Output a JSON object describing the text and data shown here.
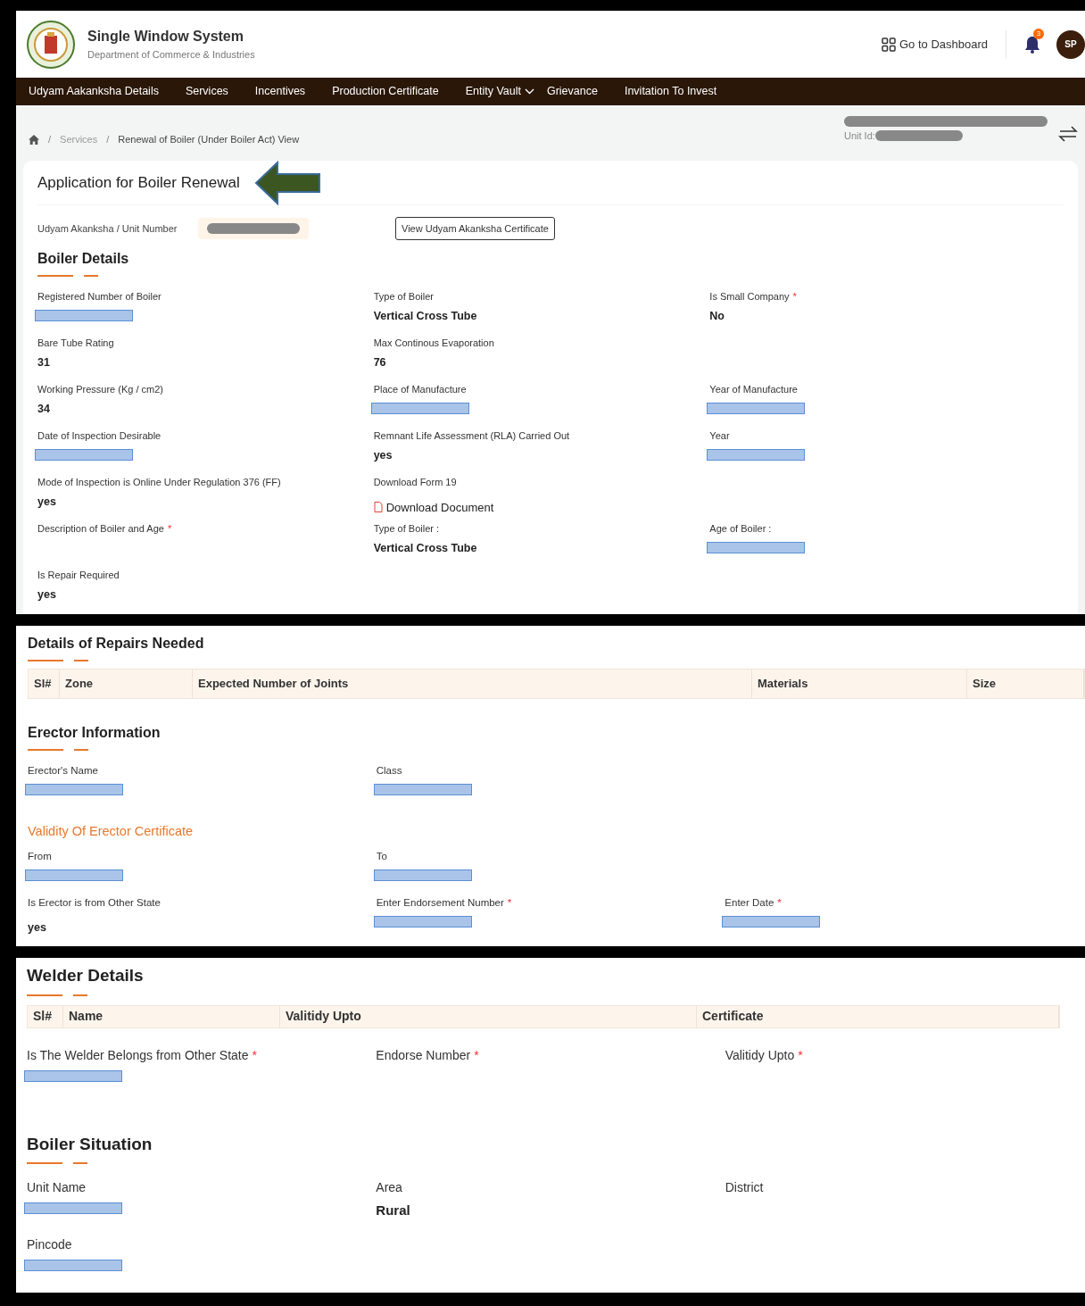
{
  "header": {
    "title": "Single Window System",
    "subtitle": "Department of Commerce & Industries",
    "dashboard_link": "Go to Dashboard",
    "notification_count": "3",
    "avatar_initials": "SP"
  },
  "nav": [
    {
      "label": "Udyam Aakanksha Details",
      "dropdown": false
    },
    {
      "label": "Services",
      "dropdown": false
    },
    {
      "label": "Incentives",
      "dropdown": false
    },
    {
      "label": "Production Certificate",
      "dropdown": false
    },
    {
      "label": "Entity Vault",
      "dropdown": true
    },
    {
      "label": "Grievance",
      "dropdown": false
    },
    {
      "label": "Invitation To Invest",
      "dropdown": false
    }
  ],
  "breadcrumb": [
    {
      "kind": "separator",
      "text": "/"
    },
    {
      "kind": "link",
      "text": "Services"
    },
    {
      "kind": "separator",
      "text": "/"
    },
    {
      "kind": "current",
      "text": "Renewal of Boiler (Under Boiler Act) View"
    }
  ],
  "unit": {
    "name_redacted": true,
    "id_label": "Unit Id:",
    "id_redacted": true
  },
  "application": {
    "title": "Application for Boiler Renewal",
    "unit_number_label": "Udyam Akanksha / Unit Number",
    "unit_number_redacted": true,
    "certificate_button": "View Udyam Akanksha Certificate"
  },
  "boiler_details": {
    "heading": "Boiler Details",
    "rows": [
      [
        {
          "label": "Registered Number of Boiler",
          "kind": "redacted"
        },
        {
          "label": "Type of Boiler",
          "kind": "text",
          "value": "Vertical Cross Tube"
        },
        {
          "label": "Is Small Company",
          "required_mark": "*",
          "kind": "text",
          "value": "No"
        }
      ],
      [
        {
          "label": "Bare Tube Rating",
          "kind": "text",
          "value": "31"
        },
        {
          "label": "Max Continous Evaporation",
          "kind": "text",
          "value": "76"
        }
      ],
      [
        {
          "label": "Working Pressure (Kg / cm2)",
          "kind": "text",
          "value": "34"
        },
        {
          "label": "Place of Manufacture",
          "kind": "redacted"
        },
        {
          "label": "Year of Manufacture",
          "kind": "redacted"
        }
      ],
      [
        {
          "label": "Date of Inspection Desirable",
          "kind": "redacted"
        },
        {
          "label": "Remnant Life Assessment (RLA) Carried Out",
          "kind": "text",
          "value": "yes"
        },
        {
          "label": "Year",
          "kind": "redacted"
        }
      ],
      [
        {
          "label": "Mode of Inspection is Online Under Regulation 376 (FF)",
          "kind": "text",
          "value": "yes"
        },
        {
          "label": "Download Form 19",
          "kind": "link",
          "value": "Download Document"
        }
      ],
      [
        {
          "label": "Description of Boiler and Age",
          "required_mark": "*",
          "kind": "none"
        },
        {
          "label": "Type of Boiler :",
          "kind": "text",
          "value": "Vertical Cross Tube"
        },
        {
          "label": "Age of Boiler :",
          "kind": "redacted"
        }
      ],
      [
        {
          "label": "Is Repair Required",
          "kind": "text",
          "value": "yes"
        }
      ]
    ]
  },
  "repairs": {
    "heading": "Details of Repairs Needed",
    "columns": [
      "Sl#",
      "Zone",
      "Expected Number of Joints",
      "Materials",
      "Size"
    ]
  },
  "erector": {
    "heading": "Erector Information",
    "rows": [
      [
        {
          "label": "Erector's Name",
          "kind": "redacted"
        },
        {
          "label": "Class",
          "kind": "redacted"
        }
      ]
    ],
    "subheading": "Validity Of Erector Certificate",
    "validity_rows": [
      [
        {
          "label": "From",
          "kind": "redacted"
        },
        {
          "label": "To",
          "kind": "redacted"
        }
      ],
      [
        {
          "label": "Is Erector is from Other State",
          "kind": "text",
          "value": "yes"
        },
        {
          "label": "Enter Endorsement Number",
          "required_mark": "*",
          "kind": "redacted"
        },
        {
          "label": "Enter Date",
          "required_mark": "*",
          "kind": "redacted"
        }
      ]
    ]
  },
  "welder": {
    "heading": "Welder Details",
    "columns": [
      "Sl#",
      "Name",
      "Valitidy Upto",
      "Certificate"
    ],
    "form_fields": [
      [
        {
          "label": "Is The Welder Belongs from Other State",
          "required_mark": "*",
          "kind": "redacted"
        },
        {
          "label": "Endorse Number",
          "required_mark": "*",
          "kind": "none"
        },
        {
          "label": "Valitidy Upto",
          "required_mark": "*",
          "kind": "none"
        }
      ]
    ]
  },
  "situation": {
    "heading": "Boiler Situation",
    "rows": [
      [
        {
          "label": "Unit Name",
          "kind": "redacted"
        },
        {
          "label": "Area",
          "kind": "text",
          "value": "Rural"
        },
        {
          "label": "District",
          "kind": "none"
        }
      ],
      [
        {
          "label": "Pincode",
          "kind": "redacted"
        }
      ]
    ]
  }
}
